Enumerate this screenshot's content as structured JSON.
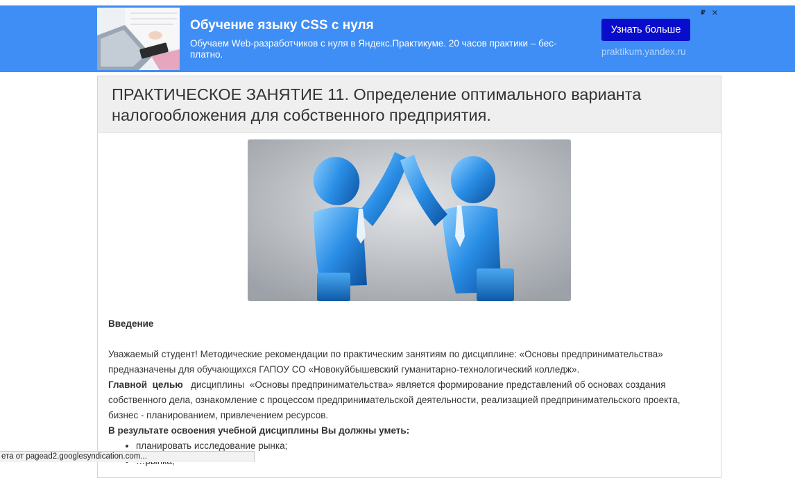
{
  "ad": {
    "title": "Обучение языку CSS с нуля",
    "text": "Обучаем Web-разработчиков с нуля в Яндекс.Практикуме. 20 часов практики – бес-платно.",
    "button_label": "Узнать больше",
    "domain": "praktikum.yandex.ru",
    "info_glyph": "₽",
    "close_glyph": "×",
    "image_icon": "laptop-desk-photo",
    "background_color": "#3f8ef5",
    "button_color": "#0a0ccc"
  },
  "article": {
    "title": "ПРАКТИЧЕСКОЕ ЗАНЯТИЕ 11. Определение оптимального варианта налогообложения для собственного предприятия.",
    "hero_image_icon": "business-high-five-illustration",
    "intro_heading": "Введение",
    "paragraph1": "Уважаемый студент! Методические рекомендации по практическим занятиям по дисциплине: «Основы предпринимательства» предназначены для обучающихся ГАПОУ СО «Новокуйбышевский гуманитарно-технологический колледж».",
    "goal_label": "Главной  целью",
    "goal_text": "   дисциплины  «Основы предпринимательства» является формирование представлений об основах создания собственного дела, ознакомление с процессом предпринимательской деятельности, реализацией предпринимательского проекта, бизнес - планированием, привлечением ресурсов.",
    "skills_heading": "В результате освоения учебной дисциплины Вы должны уметь:",
    "skills": [
      "планировать исследование рынка;",
      "…рынка;"
    ]
  },
  "statusbar": {
    "text": "ета от pagead2.googlesyndication.com..."
  }
}
